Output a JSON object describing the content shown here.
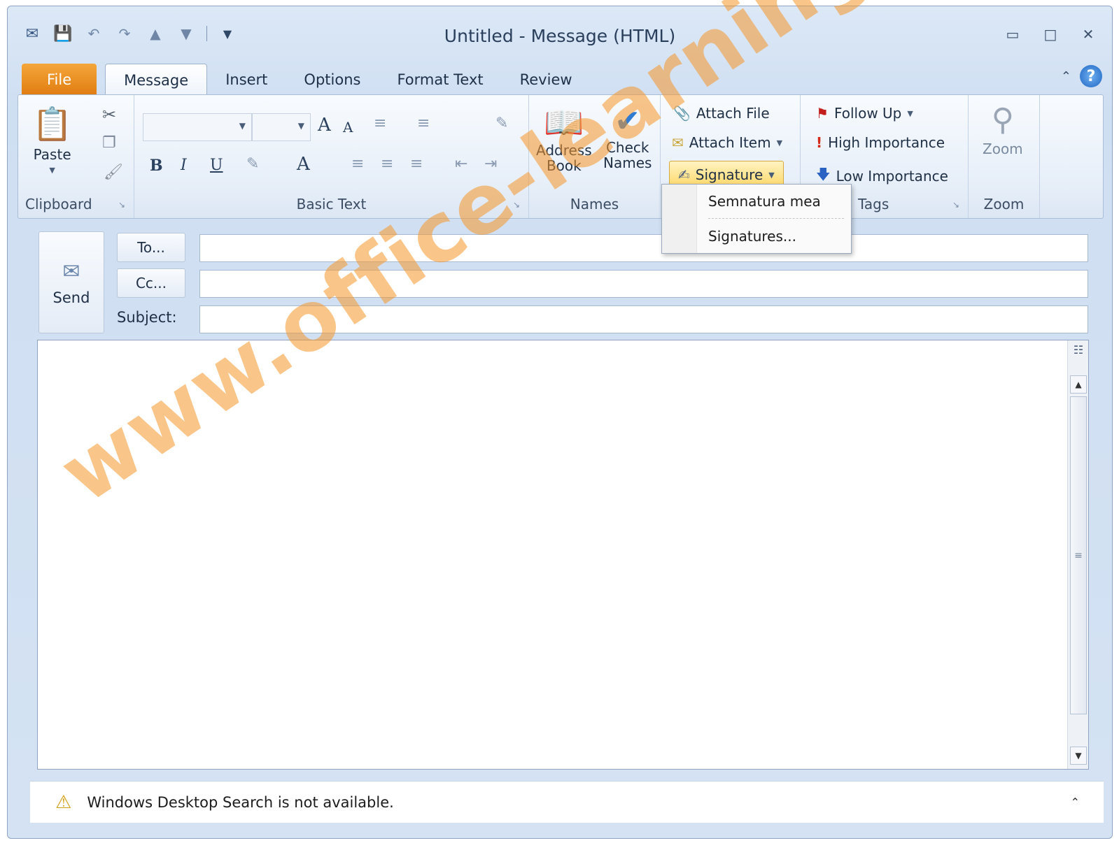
{
  "window": {
    "title": "Untitled  -  Message (HTML)"
  },
  "quick_access": [
    "app-icon",
    "save-icon",
    "undo-icon",
    "redo-icon",
    "previous-icon",
    "next-icon",
    "customize-icon"
  ],
  "tabs": [
    {
      "label": "File"
    },
    {
      "label": "Message"
    },
    {
      "label": "Insert"
    },
    {
      "label": "Options"
    },
    {
      "label": "Format Text"
    },
    {
      "label": "Review"
    }
  ],
  "ribbon": {
    "clipboard": {
      "label": "Clipboard",
      "paste": "Paste"
    },
    "basic_text": {
      "label": "Basic Text",
      "bold": "B",
      "italic": "I",
      "underline": "U",
      "grow_font": "A",
      "shrink_font": "A",
      "font_color": "A"
    },
    "names": {
      "label": "Names",
      "address_book_1": "Address",
      "address_book_2": "Book",
      "check_names_1": "Check",
      "check_names_2": "Names"
    },
    "include": {
      "attach_file": "Attach File",
      "attach_item": "Attach Item",
      "signature": "Signature"
    },
    "tags": {
      "label": "Tags",
      "follow_up": "Follow Up",
      "high_importance": "High Importance",
      "low_importance": "Low Importance"
    },
    "zoom": {
      "label": "Zoom",
      "button": "Zoom"
    }
  },
  "signature_menu": {
    "items": [
      "Semnatura mea",
      "Signatures..."
    ]
  },
  "header": {
    "send": "Send",
    "to_button": "To...",
    "cc_button": "Cc...",
    "subject_label": "Subject:",
    "to_value": "",
    "cc_value": "",
    "subject_value": ""
  },
  "status": {
    "message": "Windows Desktop Search is not available."
  },
  "watermark": "www.office-learning.ro",
  "colors": {
    "file_tab": "#e88a1a",
    "accent": "#1e66c2",
    "watermark": "#f59628"
  }
}
